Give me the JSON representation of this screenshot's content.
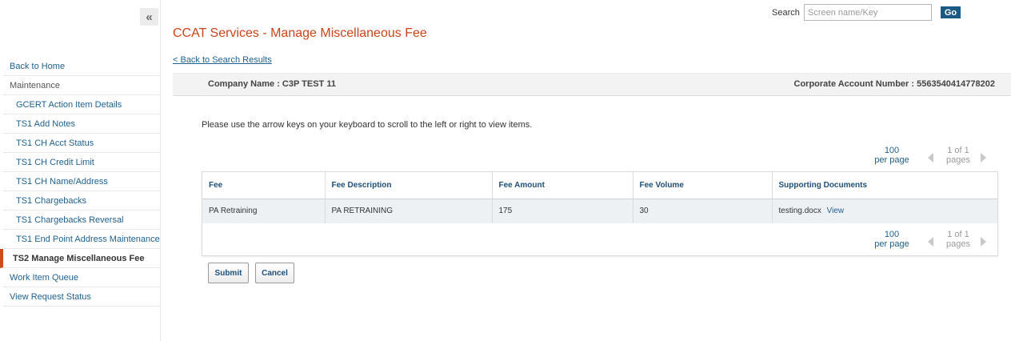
{
  "sidebar": {
    "collapse_glyph": "«",
    "items": [
      {
        "label": "Back to Home"
      },
      {
        "label": "Maintenance"
      },
      {
        "label": "GCERT Action Item Details"
      },
      {
        "label": "TS1 Add Notes"
      },
      {
        "label": "TS1 CH Acct Status"
      },
      {
        "label": "TS1 CH Credit Limit"
      },
      {
        "label": "TS1 CH Name/Address"
      },
      {
        "label": "TS1 Chargebacks"
      },
      {
        "label": "TS1 Chargebacks Reversal"
      },
      {
        "label": "TS1 End Point Address Maintenance"
      },
      {
        "label": "TS2 Manage Miscellaneous Fee"
      },
      {
        "label": "Work Item Queue"
      },
      {
        "label": "View Request Status"
      }
    ],
    "active_item": "TS2 Manage Miscellaneous Fee"
  },
  "header": {
    "search_label": "Search",
    "search_placeholder": "Screen name/Key",
    "search_value": "",
    "go_label": "Go"
  },
  "main": {
    "title": "CCAT Services - Manage Miscellaneous Fee",
    "back_link": "< Back to Search Results",
    "company_name": "Company Name : C3P TEST 11",
    "corporate_account": "Corporate Account Number : 5563540414778202",
    "hint": "Please use the arrow keys on your keyboard to scroll to the left or right to view items.",
    "pagination": {
      "per_page_value": "100",
      "per_page_label": "per page",
      "page_info": "1 of 1",
      "pages_label": "pages"
    },
    "table": {
      "columns": [
        "Fee",
        "Fee Description",
        "Fee Amount",
        "Fee Volume",
        "Supporting Documents"
      ],
      "rows": [
        {
          "fee": "PA Retraining",
          "description": "PA RETRAINING",
          "amount": "175",
          "volume": "30",
          "document": "testing.docx",
          "view_label": "View"
        }
      ]
    },
    "buttons": {
      "submit_label": "Submit",
      "cancel_label": "Cancel"
    }
  },
  "colors": {
    "accent": "#c8441a",
    "link": "#1f5f8b",
    "go_button": "#1c5a86",
    "active_marker": "#d04a1c"
  },
  "icons": {
    "collapse": "double-chevron-left-icon",
    "prev_page": "triangle-left-icon",
    "next_page": "triangle-right-icon"
  }
}
